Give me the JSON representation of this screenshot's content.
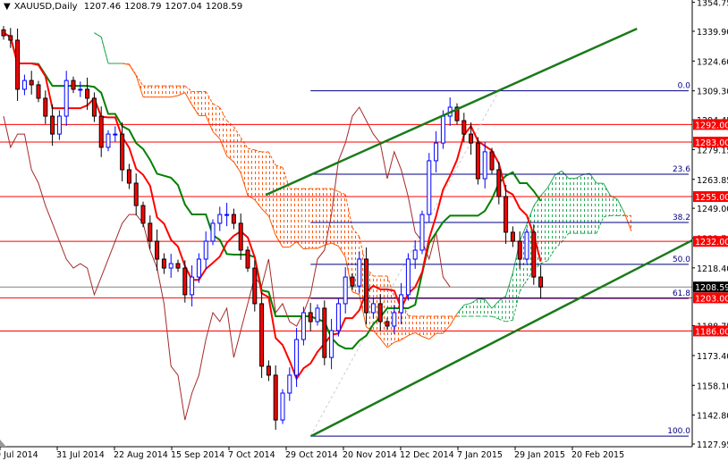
{
  "header": {
    "symbol": "XAUUSD,Daily",
    "open": "1207.46",
    "high": "1208.79",
    "low": "1207.04",
    "close": "1208.59"
  },
  "colors": {
    "bull": "#0000ff",
    "bear": "#ff0000",
    "tenkan": "#ff0000",
    "kijun": "#008000",
    "chikou": "#a52a2a",
    "cloud_up": "#22aa55",
    "cloud_down": "#ff5500",
    "level": "#ff0000",
    "fib": "#000080",
    "trend": "#1a7a1a",
    "current": "#808080"
  },
  "chart_data": {
    "type": "candlestick",
    "title": "XAUUSD,Daily",
    "ylim": [
      1127.95,
      1354.75
    ],
    "closes": [
      1337.6,
      1335.3,
      1310.1,
      1314.6,
      1312.4,
      1305.5,
      1296.3,
      1287.1,
      1296.3,
      1314.6,
      1310.1,
      1310.1,
      1305.5,
      1296.3,
      1280.3,
      1287.1,
      1287.1,
      1268.8,
      1261.9,
      1250.4,
      1241.3,
      1232.1,
      1222.9,
      1218.3,
      1220.6,
      1218.3,
      1204.6,
      1213.7,
      1222.9,
      1232.1,
      1241.3,
      1245.8,
      1245.8,
      1241.3,
      1227.5,
      1218.3,
      1200.0,
      1167.9,
      1163.3,
      1140.3,
      1154.1,
      1163.3,
      1181.6,
      1195.4,
      1190.8,
      1197.7,
      1172.4,
      1186.2,
      1200.0,
      1213.7,
      1209.1,
      1222.9,
      1195.4,
      1200.0,
      1190.8,
      1188.5,
      1195.4,
      1204.6,
      1222.9,
      1227.5,
      1245.8,
      1273.4,
      1282.5,
      1296.3,
      1300.9,
      1294.0,
      1287.1,
      1282.5,
      1264.2,
      1278.0,
      1268.8,
      1255.0,
      1236.7,
      1232.1,
      1222.9,
      1236.7,
      1213.7,
      1208.59
    ],
    "y_ticks": [
      "1354.75",
      "1339.90",
      "1324.60",
      "1309.30",
      "1294.45",
      "1279.15",
      "1263.85",
      "1249.00",
      "1233.70",
      "1218.40",
      "1188.75",
      "1173.40",
      "1158.10",
      "1142.80",
      "1127.95"
    ],
    "x_labels": [
      "9 Jul 2014",
      "31 Jul 2014",
      "22 Aug 2014",
      "15 Sep 2014",
      "7 Oct 2014",
      "29 Oct 2014",
      "20 Nov 2014",
      "12 Dec 2014",
      "7 Jan 2015",
      "29 Jan 2015",
      "20 Feb 2015"
    ],
    "levels": [
      {
        "price": 1292.0,
        "label": "1292.00"
      },
      {
        "price": 1283.0,
        "label": "1283.00"
      },
      {
        "price": 1255.0,
        "label": "1255.00"
      },
      {
        "price": 1232.0,
        "label": "1232.00"
      },
      {
        "price": 1203.0,
        "label": "1203.00"
      },
      {
        "price": 1186.0,
        "label": "1186.00"
      }
    ],
    "current_price": {
      "price": 1208.59,
      "label": "1208.59"
    },
    "fibonacci": [
      {
        "price": 1309.3,
        "label": "0.0"
      },
      {
        "price": 1266.5,
        "label": "23.6"
      },
      {
        "price": 1241.7,
        "label": "38.2"
      },
      {
        "price": 1220.2,
        "label": "50.0"
      },
      {
        "price": 1202.7,
        "label": "61.8"
      },
      {
        "price": 1132.0,
        "label": "100.0"
      }
    ],
    "fib_start_bar": 44,
    "trendlines": [
      {
        "bar1": 37.6,
        "price1": 1255.9,
        "bar2": 90.8,
        "price2": 1341.2
      },
      {
        "bar1": 44.1,
        "price1": 1132.0,
        "bar2": 98.9,
        "price2": 1232.9
      }
    ],
    "ichimoku": {
      "tenkan": 5,
      "kijun": 13,
      "senkou_b": 26,
      "shift": 13
    }
  }
}
